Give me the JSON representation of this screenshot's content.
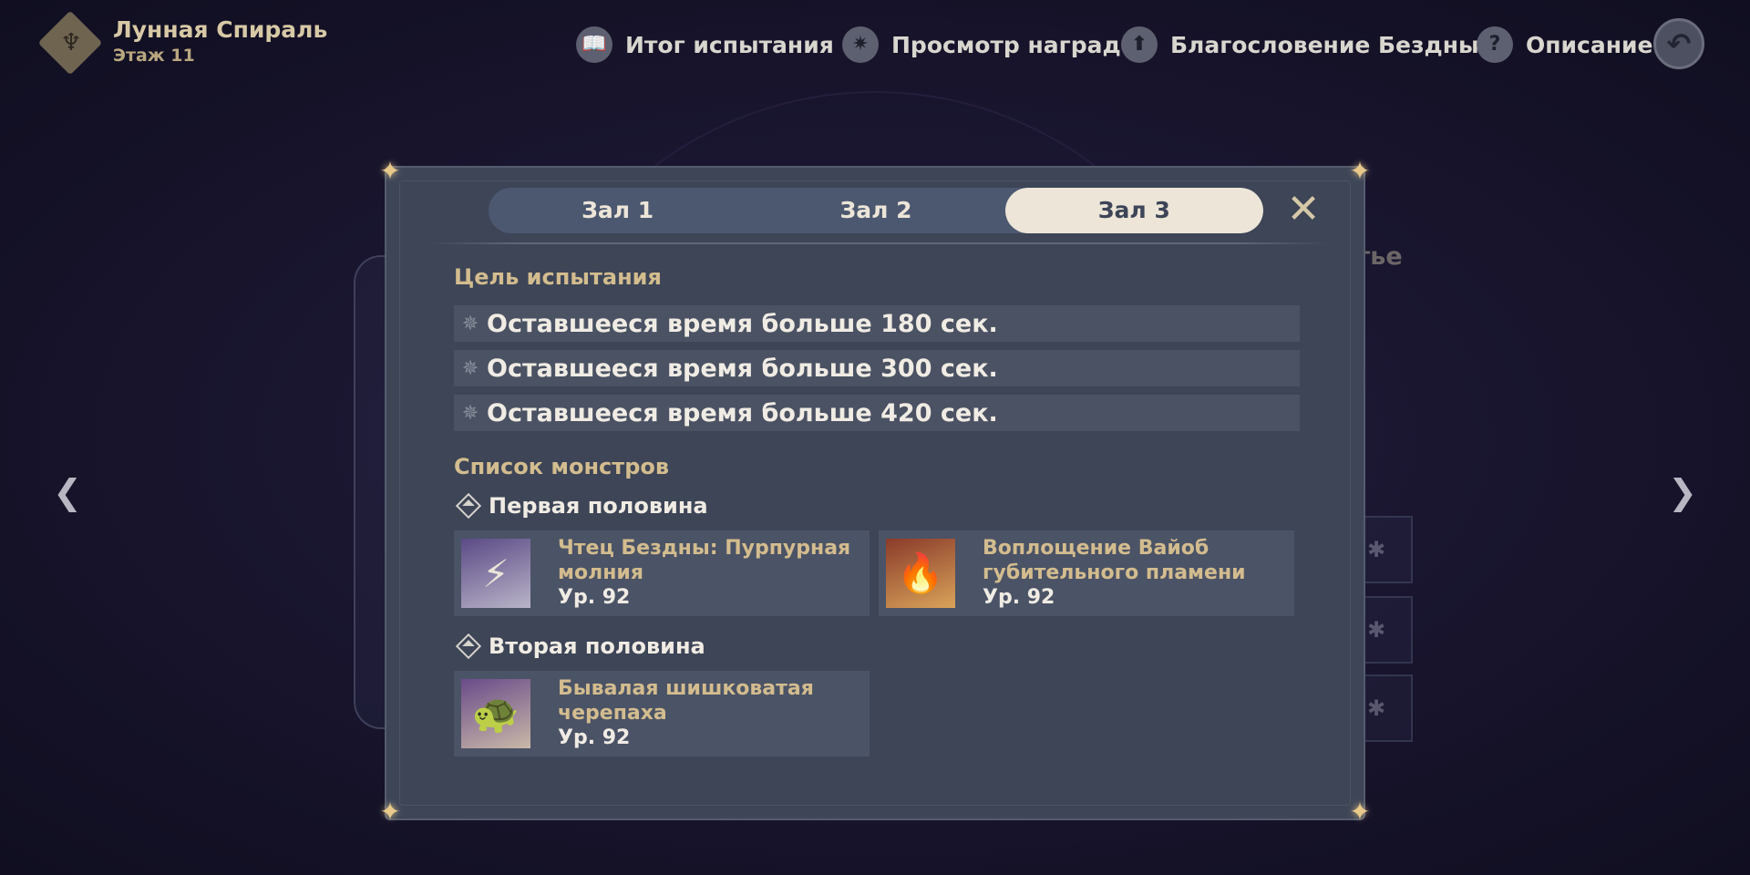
{
  "header": {
    "title": "Лунная Спираль",
    "subtitle": "Этаж 11",
    "nav": [
      {
        "icon": "book-icon",
        "glyph": "📖",
        "label": "Итог испытания"
      },
      {
        "icon": "star-badge-icon",
        "glyph": "✷",
        "label": "Просмотр наград"
      },
      {
        "icon": "arrow-up-icon",
        "glyph": "⬆",
        "label": "Благословение Бездны"
      },
      {
        "icon": "question-icon",
        "glyph": "?",
        "label": "Описание"
      }
    ],
    "back_icon": "back-arrow-icon",
    "back_glyph": "↶"
  },
  "background": {
    "partial_text": "утье",
    "slot_glyph": "✱"
  },
  "side_nav": {
    "left_glyph": "❮",
    "right_glyph": "❯"
  },
  "modal": {
    "tabs": [
      {
        "label": "Зал 1",
        "active": false
      },
      {
        "label": "Зал 2",
        "active": false
      },
      {
        "label": "Зал 3",
        "active": true
      }
    ],
    "close_glyph": "✕",
    "goals_title": "Цель испытания",
    "goals": [
      "Оставшееся время больше 180 сек.",
      "Оставшееся время больше 300 сек.",
      "Оставшееся время больше 420 сек."
    ],
    "goal_star_glyph": "✵",
    "monsters_title": "Список монстров",
    "first_half": {
      "label": "Первая половина",
      "monsters": [
        {
          "name": "Чтец Бездны: Пурпурная молния",
          "level": "Ур. 92",
          "portrait_glyph": "⚡",
          "portrait_color": "#5b4a86"
        },
        {
          "name": "Воплощение Вайоб губительного пламени",
          "level": "Ур. 92",
          "portrait_glyph": "🔥",
          "portrait_color": "#8a3b2a"
        }
      ]
    },
    "second_half": {
      "label": "Вторая половина",
      "monsters": [
        {
          "name": "Бывалая шишковатая черепаха",
          "level": "Ур. 92",
          "portrait_glyph": "🐢",
          "portrait_color": "#6a4b8a"
        }
      ]
    }
  },
  "colors": {
    "modal_bg": "#3d4557",
    "accent_gold": "#d3bc8e",
    "tab_active_bg": "#ece5d8"
  }
}
